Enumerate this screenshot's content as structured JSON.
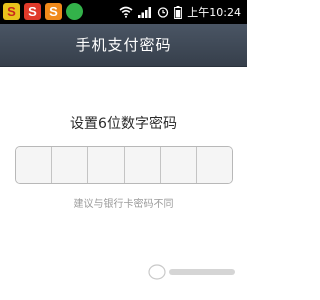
{
  "status_bar": {
    "app_icons": [
      "S",
      "S",
      "S",
      ""
    ],
    "time": "上午10:24",
    "icons": [
      "wifi-icon",
      "signal-icon",
      "alarm-icon",
      "battery-icon"
    ]
  },
  "header": {
    "title": "手机支付密码"
  },
  "main": {
    "prompt": "设置6位数字密码",
    "pin_cells": [
      "",
      "",
      "",
      "",
      "",
      ""
    ],
    "hint": "建议与银行卡密码不同"
  },
  "colors": {
    "titlebar": "#3f4956",
    "status_bar": "#000000",
    "prompt_text": "#2a2a2a",
    "hint_text": "#9a9a9a"
  }
}
